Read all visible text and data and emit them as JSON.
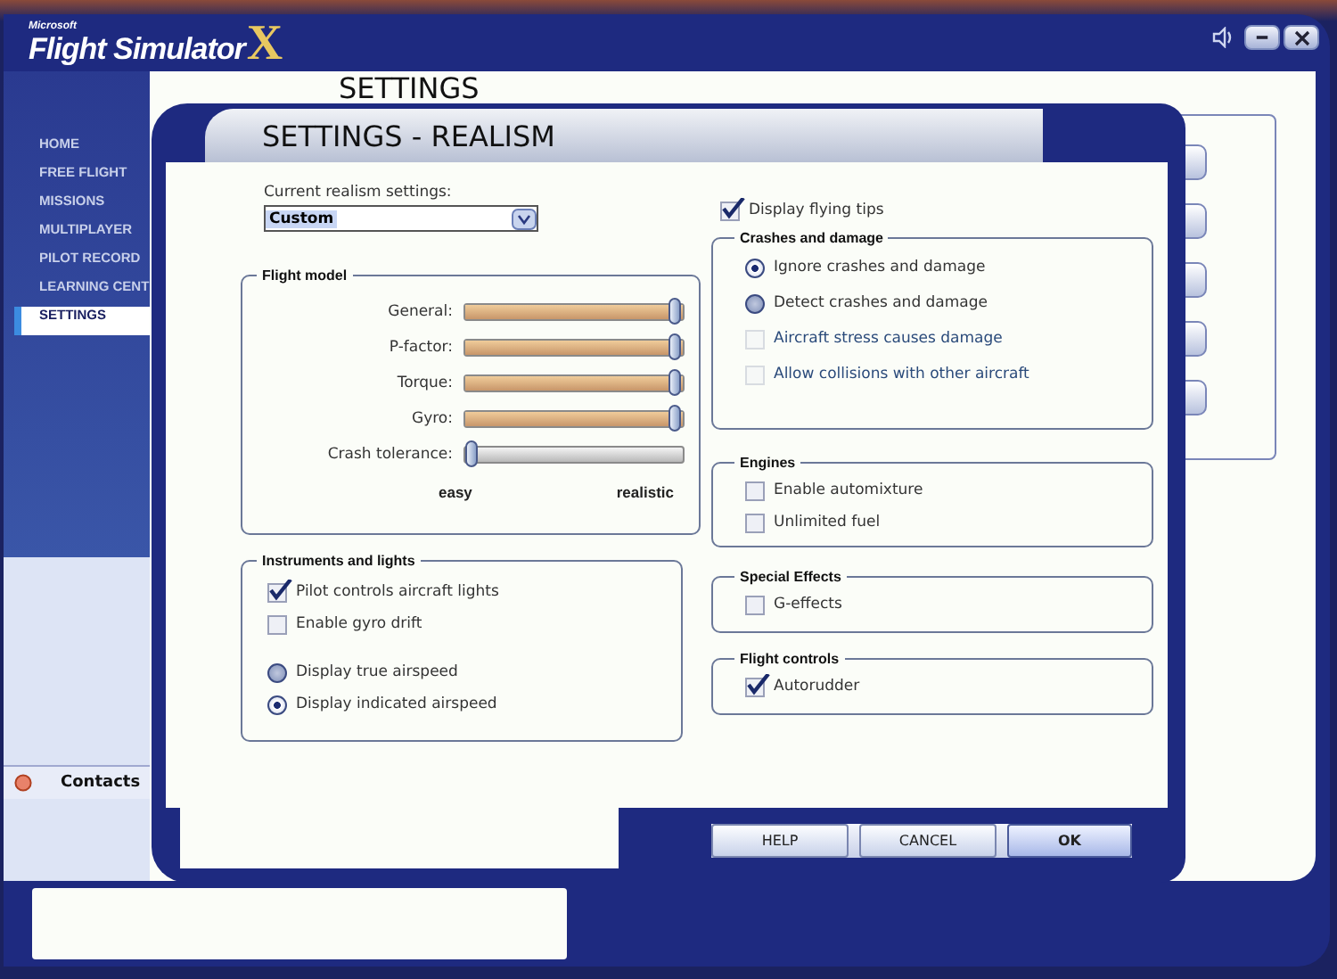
{
  "app": {
    "brand_small": "Microsoft",
    "brand": "Flight Simulator",
    "brand_mark": "X",
    "page_title": "SETTINGS"
  },
  "nav": [
    {
      "label": "HOME",
      "selected": false
    },
    {
      "label": "FREE FLIGHT",
      "selected": false
    },
    {
      "label": "MISSIONS",
      "selected": false
    },
    {
      "label": "MULTIPLAYER",
      "selected": false
    },
    {
      "label": "PILOT RECORD",
      "selected": false
    },
    {
      "label": "LEARNING CENT",
      "selected": false
    },
    {
      "label": "SETTINGS",
      "selected": true
    }
  ],
  "contacts_tab": {
    "label": "Contacts"
  },
  "dialog": {
    "title": "SETTINGS - REALISM",
    "realism": {
      "label": "Current realism settings:",
      "value": "Custom"
    },
    "flight_model": {
      "title": "Flight model",
      "scale_min": "easy",
      "scale_max": "realistic",
      "sliders": [
        {
          "label": "General:",
          "level": 1
        },
        {
          "label": "P-factor:",
          "level": 1
        },
        {
          "label": "Torque:",
          "level": 1
        },
        {
          "label": "Gyro:",
          "level": 1
        },
        {
          "label": "Crash tolerance:",
          "level": 0
        }
      ]
    },
    "instruments": {
      "title": "Instruments and lights",
      "options": [
        {
          "kind": "checkbox",
          "label": "Pilot controls aircraft lights",
          "checked": true,
          "disabled": false
        },
        {
          "kind": "checkbox",
          "label": "Enable gyro drift",
          "checked": false,
          "disabled": false
        },
        {
          "kind": "radio",
          "label": "Display true airspeed",
          "checked": false,
          "disabled": false
        },
        {
          "kind": "radio",
          "label": "Display indicated airspeed",
          "checked": true,
          "disabled": false
        }
      ]
    },
    "display_tips": {
      "label": "Display flying tips",
      "checked": true
    },
    "groups": [
      {
        "title": "Crashes and damage",
        "options": [
          {
            "kind": "radio",
            "label": "Ignore crashes and damage",
            "checked": true,
            "disabled": false
          },
          {
            "kind": "radio",
            "label": "Detect crashes and damage",
            "checked": false,
            "disabled": false
          },
          {
            "kind": "checkbox",
            "label": "Aircraft stress causes damage",
            "checked": false,
            "disabled": true
          },
          {
            "kind": "checkbox",
            "label": "Allow collisions with other aircraft",
            "checked": false,
            "disabled": true
          }
        ]
      },
      {
        "title": "Engines",
        "options": [
          {
            "kind": "checkbox",
            "label": "Enable automixture",
            "checked": false,
            "disabled": false
          },
          {
            "kind": "checkbox",
            "label": "Unlimited fuel",
            "checked": false,
            "disabled": false
          }
        ]
      },
      {
        "title": "Special Effects",
        "options": [
          {
            "kind": "checkbox",
            "label": "G-effects",
            "checked": false,
            "disabled": false
          }
        ]
      },
      {
        "title": "Flight controls",
        "options": [
          {
            "kind": "checkbox",
            "label": "Autorudder",
            "checked": true,
            "disabled": false
          }
        ]
      }
    ],
    "buttons": [
      {
        "label": "HELP",
        "default": false
      },
      {
        "label": "CANCEL",
        "default": false
      },
      {
        "label": "OK",
        "default": true
      }
    ]
  }
}
